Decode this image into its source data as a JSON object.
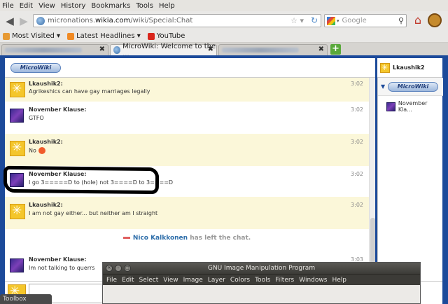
{
  "browser": {
    "menu": [
      "File",
      "Edit",
      "View",
      "History",
      "Bookmarks",
      "Tools",
      "Help"
    ],
    "url_prefix": "micronations.",
    "url_domain": "wikia.com",
    "url_path": "/wiki/Special:Chat",
    "search_placeholder": "Google",
    "bookmarks": [
      "Most Visited ▾",
      "Latest Headlines ▾",
      "YouTube"
    ],
    "tabs": [
      {
        "label": ""
      },
      {
        "label": "MicroWiki: Welcome to the ..."
      },
      {
        "label": ""
      }
    ]
  },
  "chat": {
    "logo": "MicroWiki",
    "current_user": "Lkaushik2",
    "messages": [
      {
        "user": "Lkaushik2:",
        "text": "Agrikeshics can have gay marriages legally",
        "time": "3:02",
        "avatar": "yellow",
        "highlight": true
      },
      {
        "user": "November Klause:",
        "text": "GTFO",
        "time": "3:02",
        "avatar": "purple",
        "highlight": false
      },
      {
        "user": "Lkaushik2:",
        "text": "No",
        "time": "3:02",
        "avatar": "yellow",
        "highlight": true,
        "smiley": true
      },
      {
        "user": "November Klause:",
        "text": "I go 3=====D to (hole) not 3====D to 3====D",
        "time": "3:02",
        "avatar": "purple",
        "highlight": false
      },
      {
        "user": "Lkaushik2:",
        "text": "I am not gay either... but neither am I straight",
        "time": "3:02",
        "avatar": "yellow",
        "highlight": true
      },
      {
        "user": "November Klause:",
        "text": "Im not talking to querrs",
        "time": "3:03",
        "avatar": "purple",
        "highlight": false
      }
    ],
    "inline_alert": {
      "who": "Nico Kalkkonen",
      "text": "has left the chat."
    },
    "sidebar_logo": "MicroWiki",
    "sidebar_users": [
      "November Kla..."
    ]
  },
  "gimp": {
    "title": "GNU Image Manipulation Program",
    "menu": [
      "File",
      "Edit",
      "Select",
      "View",
      "Image",
      "Layer",
      "Colors",
      "Tools",
      "Filters",
      "Windows",
      "Help"
    ]
  },
  "toolbox": "Toolbox"
}
